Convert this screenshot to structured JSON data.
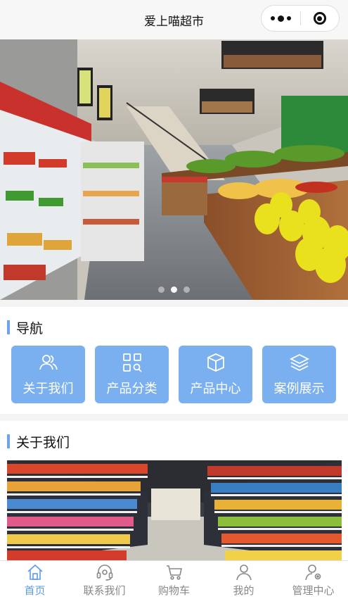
{
  "header": {
    "title": "爱上喵超市"
  },
  "banner": {
    "slide_count": 3,
    "active_index": 1
  },
  "nav_section": {
    "title": "导航",
    "items": [
      {
        "label": "关于我们",
        "icon": "users-icon"
      },
      {
        "label": "产品分类",
        "icon": "grid-search-icon"
      },
      {
        "label": "产品中心",
        "icon": "box-icon"
      },
      {
        "label": "案例展示",
        "icon": "layers-icon"
      }
    ]
  },
  "about_section": {
    "title": "关于我们"
  },
  "tabbar": {
    "items": [
      {
        "label": "首页",
        "icon": "home-icon",
        "active": true
      },
      {
        "label": "联系我们",
        "icon": "headset-icon",
        "active": false
      },
      {
        "label": "购物车",
        "icon": "cart-icon",
        "active": false
      },
      {
        "label": "我的",
        "icon": "person-icon",
        "active": false
      },
      {
        "label": "管理中心",
        "icon": "admin-icon",
        "active": false
      }
    ]
  },
  "colors": {
    "accent": "#7aaff0",
    "tab_active": "#5d9be8",
    "tab_inactive": "#888888"
  }
}
